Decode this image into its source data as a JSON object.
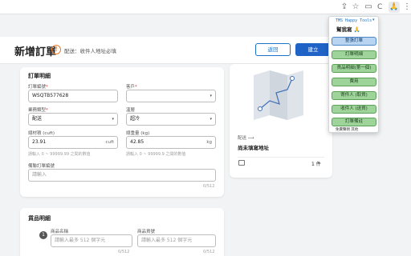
{
  "browser": {
    "extension_c": "C",
    "extension_emoji": "🙏"
  },
  "header": {
    "title": "新增訂單",
    "warning": "配送：收件人地址必填",
    "back_label": "返回",
    "create_label": "建立"
  },
  "order": {
    "section_title": "訂單明細",
    "order_no_label": "訂單編號",
    "order_no_value": "WSQTB577628",
    "client_label": "客戶",
    "type_label": "業務類型",
    "type_value": "配送",
    "temp_label": "溫層",
    "temp_value": "超冷",
    "volume_label": "總材積 (cuft)",
    "volume_value": "23.91",
    "volume_unit": "cuft",
    "volume_hint": "請輸入 0 ~ 99999.99 之間的數值",
    "weight_label": "總重量 (kg)",
    "weight_value": "42.85",
    "weight_unit": "kg",
    "weight_hint": "請輸入 0 ~ 99999.9 之間的數值",
    "related_label": "備聯訂單編號",
    "related_placeholder": "請輸入",
    "related_counter": "0/512"
  },
  "goods": {
    "section_title": "貨品明細",
    "step": "1",
    "name_label": "商品名稱",
    "name_placeholder": "請輸入最多 512 個字元",
    "name_counter": "0/512",
    "sku_label": "商品貨號",
    "sku_placeholder": "請輸入最多 512 個字元",
    "sku_counter": "0/512"
  },
  "side": {
    "delivery_label": "配送 ⟶",
    "address_unfilled": "尚未填寫地址",
    "package_count": "1 件"
  },
  "popup": {
    "brand": "TMS Happy Tools",
    "title": "幫我寫 🙏",
    "buttons": [
      "整張訂單",
      "訂單明細",
      "貨品明細(第一個)",
      "費用",
      "寄件人 (取貨)",
      "收件人 (送貨)",
      "訂單備註"
    ],
    "footer": "免費聲明 其他"
  }
}
